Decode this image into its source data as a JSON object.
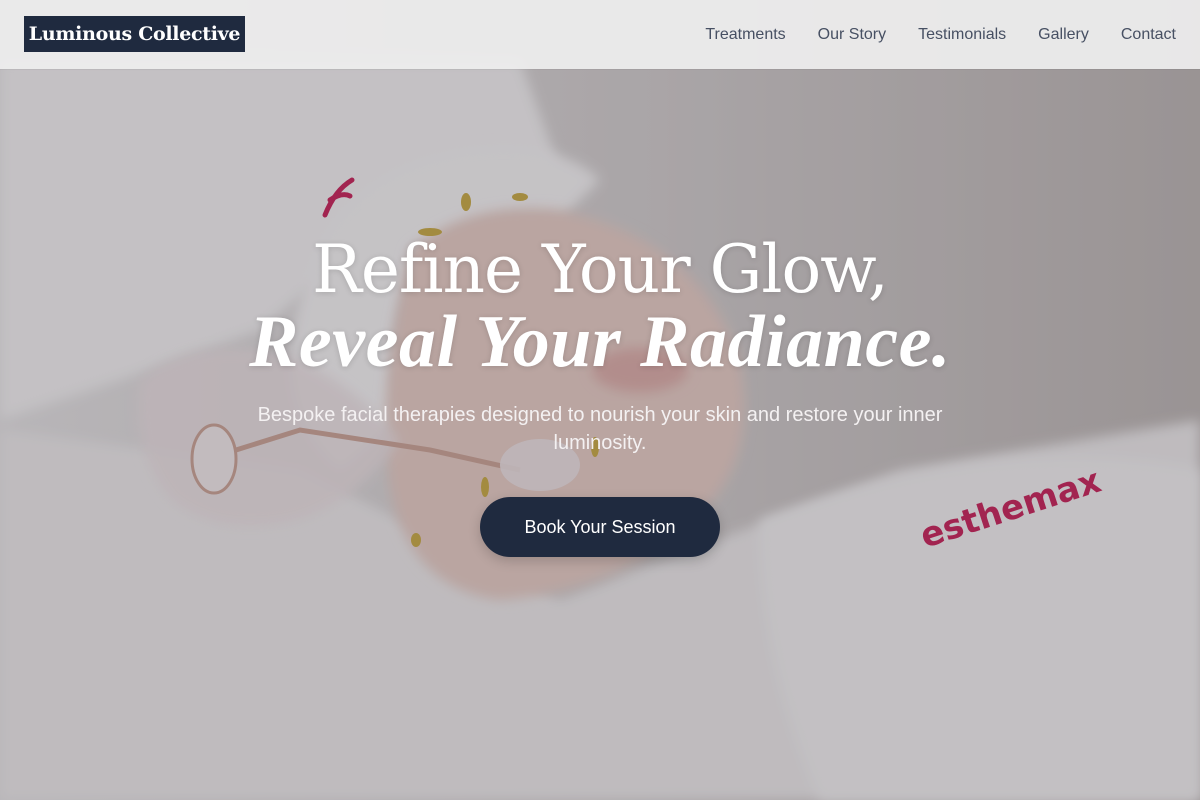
{
  "brand": {
    "name": "Luminous Collective"
  },
  "nav": {
    "items": [
      {
        "label": "Treatments"
      },
      {
        "label": "Our Story"
      },
      {
        "label": "Testimonials"
      },
      {
        "label": "Gallery"
      },
      {
        "label": "Contact"
      }
    ]
  },
  "hero": {
    "headline_line1": "Refine Your Glow,",
    "headline_line2": "Reveal Your Radiance.",
    "subtitle": "Bespoke facial therapies designed to nourish your skin and restore your inner luminosity.",
    "cta_label": "Book Your Session",
    "towel_brand_text": "esthemax"
  },
  "colors": {
    "brand_navy": "#1f2a3f",
    "nav_text": "#475063",
    "header_bg": "#eeeeee",
    "towel_logo_pink": "#c3164f"
  }
}
